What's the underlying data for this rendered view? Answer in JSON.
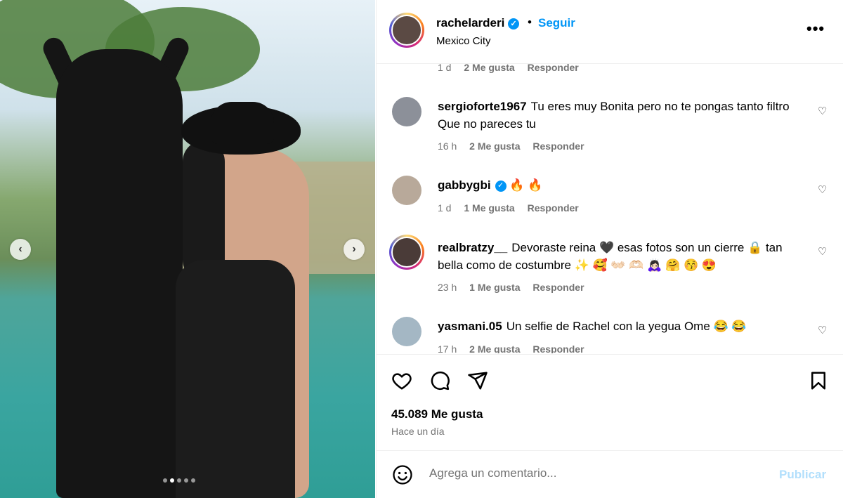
{
  "post": {
    "username": "rachelarderi",
    "verified": true,
    "follow_label": "Seguir",
    "separator": "•",
    "location": "Mexico City",
    "more_label": "•••"
  },
  "carousel": {
    "prev_label": "‹",
    "next_label": "›",
    "slide_count": 5,
    "active_slide": 2
  },
  "comments": [
    {
      "username": "",
      "text": "",
      "time": "1 d",
      "likes": "2 Me gusta",
      "reply": "Responder",
      "partial": true
    },
    {
      "username": "sergioforte1967",
      "text": "Tu eres muy Bonita pero no te pongas tanto filtro Que no pareces tu",
      "time": "16 h",
      "likes": "2 Me gusta",
      "reply": "Responder"
    },
    {
      "username": "gabbygbi",
      "verified": true,
      "text": "🔥 🔥",
      "time": "1 d",
      "likes": "1 Me gusta",
      "reply": "Responder"
    },
    {
      "username": "realbratzy__",
      "text": "Devoraste reina 🖤 esas fotos son un cierre 🔒 tan bella como de costumbre ✨ 🥰 👐🏻 🫶🏻 🙇🏻‍♀️ 🤗 😚 😍",
      "time": "23 h",
      "likes": "1 Me gusta",
      "reply": "Responder"
    },
    {
      "username": "yasmani.05",
      "text": "Un selfie de Rachel con la yegua Ome 😂 😂",
      "time": "17 h",
      "likes": "2 Me gusta",
      "reply": "Responder"
    }
  ],
  "actions": {
    "likes_label": "45.089 Me gusta",
    "time_ago": "Hace un día"
  },
  "add_comment": {
    "placeholder": "Agrega un comentario...",
    "post_label": "Publicar"
  },
  "colors": {
    "link_blue": "#0095f6",
    "publish_disabled": "#b2dffc",
    "meta_gray": "#737373"
  }
}
